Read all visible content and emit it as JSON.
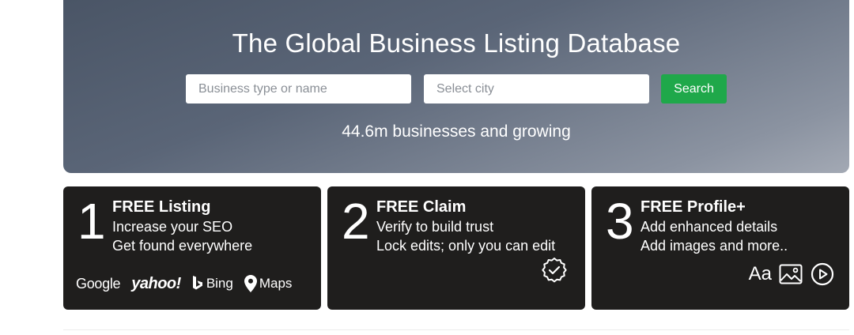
{
  "hero": {
    "title": "The Global Business Listing Database",
    "search": {
      "business_placeholder": "Business type or name",
      "city_placeholder": "Select city",
      "button_label": "Search"
    },
    "subtitle": "44.6m businesses and growing",
    "colors": {
      "search_button": "#1fa84a",
      "gradient_start": "#4a5566",
      "gradient_end": "#a3a9b4"
    }
  },
  "cards": [
    {
      "number": "1",
      "title": "FREE Listing",
      "line1": "Increase your SEO",
      "line2": "Get found everywhere",
      "logos": {
        "google": "Google",
        "yahoo": "yahoo!",
        "bing": "Bing",
        "maps": "Maps"
      }
    },
    {
      "number": "2",
      "title": "FREE Claim",
      "line1": "Verify to build trust",
      "line2": "Lock edits; only you can edit",
      "icon": "verified-check-badge-icon"
    },
    {
      "number": "3",
      "title": "FREE Profile+",
      "line1": "Add enhanced details",
      "line2": "Add images and more..",
      "icons": {
        "text": "Aa",
        "image": "image-icon",
        "video": "play-circle-icon"
      }
    }
  ],
  "colors": {
    "card_background": "#1f1e1d"
  }
}
